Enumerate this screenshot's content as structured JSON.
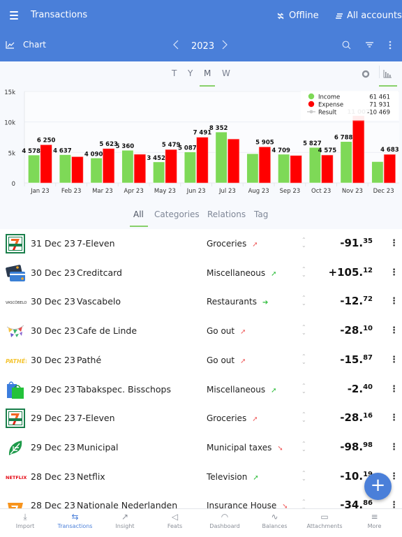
{
  "header": {
    "menu_icon": "hamburger-icon",
    "title": "Transactions",
    "offline_label": "Offline",
    "offline_icon": "sync-off-icon",
    "accounts_label": "All accounts",
    "accounts_icon": "accounts-list-icon"
  },
  "subheader": {
    "chart_label": "Chart",
    "chart_icon": "line-chart-icon",
    "year": "2023",
    "prev_icon": "chevron-left-icon",
    "next_icon": "chevron-right-icon",
    "search_icon": "search-icon",
    "filter_icon": "filter-icon",
    "more_icon": "more-vertical-icon"
  },
  "period_tabs": [
    {
      "label": "T",
      "active": false
    },
    {
      "label": "Y",
      "active": false
    },
    {
      "label": "M",
      "active": true
    },
    {
      "label": "W",
      "active": false
    }
  ],
  "chart_type_toggle": {
    "donut_icon": "donut-chart-icon",
    "bar_icon": "bar-chart-icon",
    "active": "bar"
  },
  "colors": {
    "accent": "#4a7fd9",
    "income": "#7ed957",
    "expense": "#ff0000",
    "result": "#cccccc",
    "tab_underline": "#88d06a",
    "up_red": "#f06060",
    "up_green": "#2ebd3b"
  },
  "chart_data": {
    "type": "bar",
    "categories": [
      "Jan 23",
      "Feb 23",
      "Mar 23",
      "Apr 23",
      "May 23",
      "Jun 23",
      "Jul 23",
      "Aug 23",
      "Sep 23",
      "Oct 23",
      "Nov 23",
      "Dec 23"
    ],
    "series": [
      {
        "name": "Income",
        "values": [
          4578,
          4637,
          4090,
          5360,
          3452,
          5087,
          8352,
          4800,
          4709,
          5827,
          6788,
          3500
        ],
        "labels": [
          "4 578",
          "4 637",
          "4 090",
          "5 360",
          "3 452",
          "5 087",
          "8 352",
          "",
          "4 709",
          "5 827",
          "6 788",
          ""
        ]
      },
      {
        "name": "Expense",
        "values": [
          6250,
          4300,
          5623,
          4700,
          5479,
          7491,
          7200,
          5905,
          4500,
          4575,
          10200,
          4683
        ],
        "labels": [
          "6 250",
          "",
          "5 623",
          "",
          "5 479",
          "7 491",
          "",
          "5 905",
          "",
          "4 575",
          "",
          "4 683"
        ]
      }
    ],
    "highlight": {
      "category": "Nov 23",
      "series": "Expense",
      "value": 11007,
      "label": "11 007"
    },
    "legend": [
      {
        "name": "Income",
        "total": "61 461"
      },
      {
        "name": "Expense",
        "total": "71 931"
      },
      {
        "name": "Result",
        "total": "-10 469"
      }
    ],
    "legend_position": "top-right",
    "y_ticks": [
      "0",
      "5k",
      "10k",
      "15k"
    ],
    "ylim": [
      0,
      15000
    ],
    "grid": true,
    "xlabel": "",
    "ylabel": "",
    "title": ""
  },
  "filter_tabs": [
    {
      "label": "All",
      "active": true
    },
    {
      "label": "Categories",
      "active": false
    },
    {
      "label": "Relations",
      "active": false
    },
    {
      "label": "Tag",
      "active": false
    }
  ],
  "transactions": [
    {
      "logo": "seven-eleven-logo",
      "date": "31 Dec 23",
      "payee": "7-Eleven",
      "category": "Groceries",
      "trend": "up-right",
      "trend_color": "red",
      "amount_main": "-91.",
      "amount_dec": "35"
    },
    {
      "logo": "creditcard-logo",
      "date": "30 Dec 23",
      "payee": "Creditcard",
      "category": "Miscellaneous",
      "trend": "up-right",
      "trend_color": "green",
      "amount_main": "+105.",
      "amount_dec": "12"
    },
    {
      "logo": "vascabelo-logo",
      "date": "30 Dec 23",
      "payee": "Vascabelo",
      "category": "Restaurants",
      "trend": "right",
      "trend_color": "green",
      "amount_main": "-12.",
      "amount_dec": "72"
    },
    {
      "logo": "bunting-flags-logo",
      "date": "30 Dec 23",
      "payee": "Cafe de Linde",
      "category": "Go out",
      "trend": "up-right",
      "trend_color": "red",
      "amount_main": "-28.",
      "amount_dec": "10"
    },
    {
      "logo": "pathe-logo",
      "date": "30 Dec 23",
      "payee": "Pathé",
      "category": "Go out",
      "trend": "up-right",
      "trend_color": "red",
      "amount_main": "-15.",
      "amount_dec": "87"
    },
    {
      "logo": "shopping-bags-logo",
      "date": "29 Dec 23",
      "payee": "Tabakspec. Bisschops",
      "category": "Miscellaneous",
      "trend": "up-right",
      "trend_color": "green",
      "amount_main": "-2.",
      "amount_dec": "40"
    },
    {
      "logo": "seven-eleven-logo",
      "date": "29 Dec 23",
      "payee": "7-Eleven",
      "category": "Groceries",
      "trend": "up-right",
      "trend_color": "red",
      "amount_main": "-28.",
      "amount_dec": "16"
    },
    {
      "logo": "leaf-logo",
      "date": "29 Dec 23",
      "payee": "Municipal",
      "category": "Municipal taxes",
      "trend": "down-right",
      "trend_color": "red",
      "amount_main": "-98.",
      "amount_dec": "98"
    },
    {
      "logo": "netflix-logo",
      "date": "28 Dec 23",
      "payee": "Netflix",
      "category": "Television",
      "trend": "up-right",
      "trend_color": "green",
      "amount_main": "-10.",
      "amount_dec": "19"
    },
    {
      "logo": "nationale-nederlanden-logo",
      "date": "28 Dec 23",
      "payee": "Nationale Nederlanden",
      "category": "Insurance House",
      "trend": "down-right",
      "trend_color": "red",
      "amount_main": "-34.",
      "amount_dec": "86"
    }
  ],
  "fab": {
    "label": "+",
    "icon": "add-icon"
  },
  "bottom_nav": [
    {
      "label": "Import",
      "icon": "import-icon",
      "glyph": "⤓",
      "active": false
    },
    {
      "label": "Transactions",
      "icon": "transactions-icon",
      "glyph": "⇆",
      "active": true
    },
    {
      "label": "Insight",
      "icon": "insight-icon",
      "glyph": "↗",
      "active": false
    },
    {
      "label": "Feats",
      "icon": "megaphone-icon",
      "glyph": "◁",
      "active": false
    },
    {
      "label": "Dashboard",
      "icon": "dashboard-icon",
      "glyph": "◠",
      "active": false
    },
    {
      "label": "Balances",
      "icon": "balances-icon",
      "glyph": "∿",
      "active": false
    },
    {
      "label": "Attachments",
      "icon": "archive-icon",
      "glyph": "▭",
      "active": false
    },
    {
      "label": "More",
      "icon": "menu-icon",
      "glyph": "≡",
      "active": false
    }
  ]
}
